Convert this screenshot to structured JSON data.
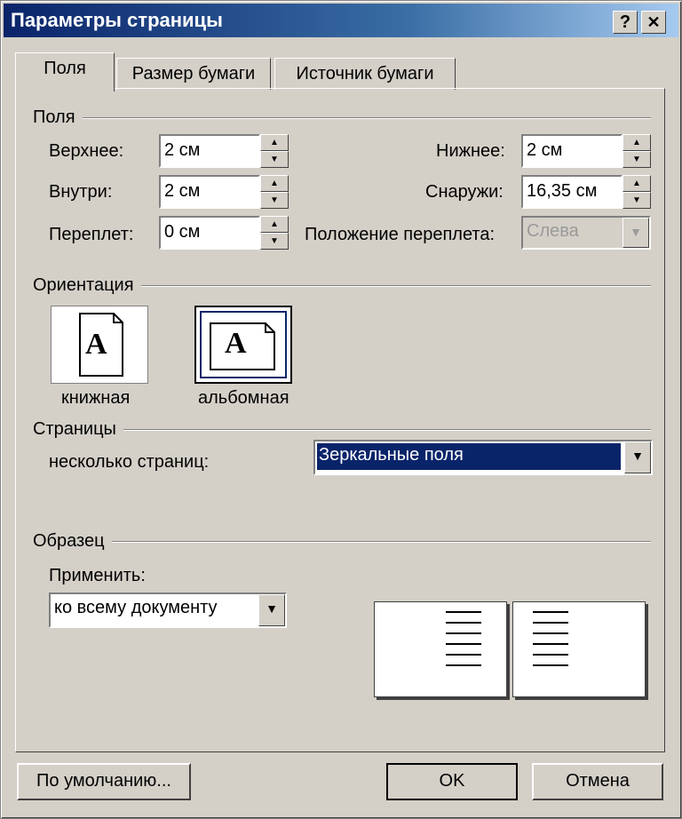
{
  "window": {
    "title": "Параметры страницы",
    "help_label": "?",
    "close_label": "✕"
  },
  "tabs": [
    {
      "label": "Поля",
      "active": true
    },
    {
      "label": "Размер бумаги",
      "active": false
    },
    {
      "label": "Источник бумаги",
      "active": false
    }
  ],
  "margins": {
    "group_label": "Поля",
    "top_label": "Верхнее:",
    "top_value": "2 см",
    "bottom_label": "Нижнее:",
    "bottom_value": "2 см",
    "inside_label": "Внутри:",
    "inside_value": "2 см",
    "outside_label": "Снаружи:",
    "outside_value": "16,35 см",
    "gutter_label": "Переплет:",
    "gutter_value": "0 см",
    "gutter_pos_label": "Положение переплета:",
    "gutter_pos_value": "Слева"
  },
  "orientation": {
    "group_label": "Ориентация",
    "portrait_label": "книжная",
    "landscape_label": "альбомная",
    "icon_letter": "A",
    "selected": "landscape"
  },
  "pages": {
    "group_label": "Страницы",
    "multiple_label": "несколько страниц:",
    "multiple_value": "Зеркальные поля"
  },
  "preview": {
    "group_label": "Образец",
    "apply_label": "Применить:",
    "apply_value": "ко всему документу"
  },
  "buttons": {
    "default_label": "По умолчанию...",
    "ok_label": "OK",
    "cancel_label": "Отмена"
  }
}
